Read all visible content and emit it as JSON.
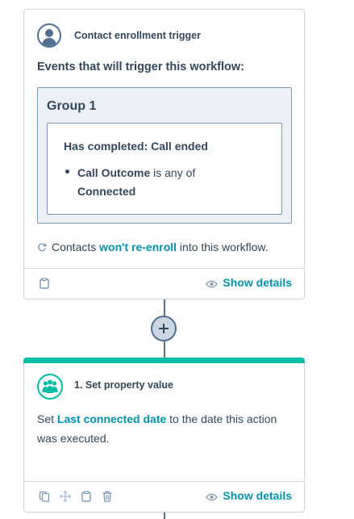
{
  "trigger": {
    "title": "Contact enrollment trigger",
    "events_label": "Events that will trigger this workflow:",
    "group_title": "Group 1",
    "filter_heading": "Has completed: Call ended",
    "filter_property": "Call Outcome",
    "filter_operator": " is any of",
    "filter_value": "Connected",
    "reenroll_prefix": "Contacts ",
    "reenroll_link": "won't re-enroll",
    "reenroll_suffix": " into this workflow.",
    "show_details": "Show details"
  },
  "action": {
    "title": "1. Set property value",
    "desc_prefix": "Set ",
    "desc_link": "Last connected date",
    "desc_suffix": " to the date this action was executed.",
    "show_details": "Show details"
  },
  "colors": {
    "accent": "#0091ae",
    "action_bar": "#00bda5",
    "text": "#33475b",
    "border": "#cbd6e2"
  },
  "icons": {
    "trigger": "contact-avatar-icon",
    "action": "people-group-icon",
    "plus": "add-action-icon",
    "show_details": "eye-icon"
  }
}
